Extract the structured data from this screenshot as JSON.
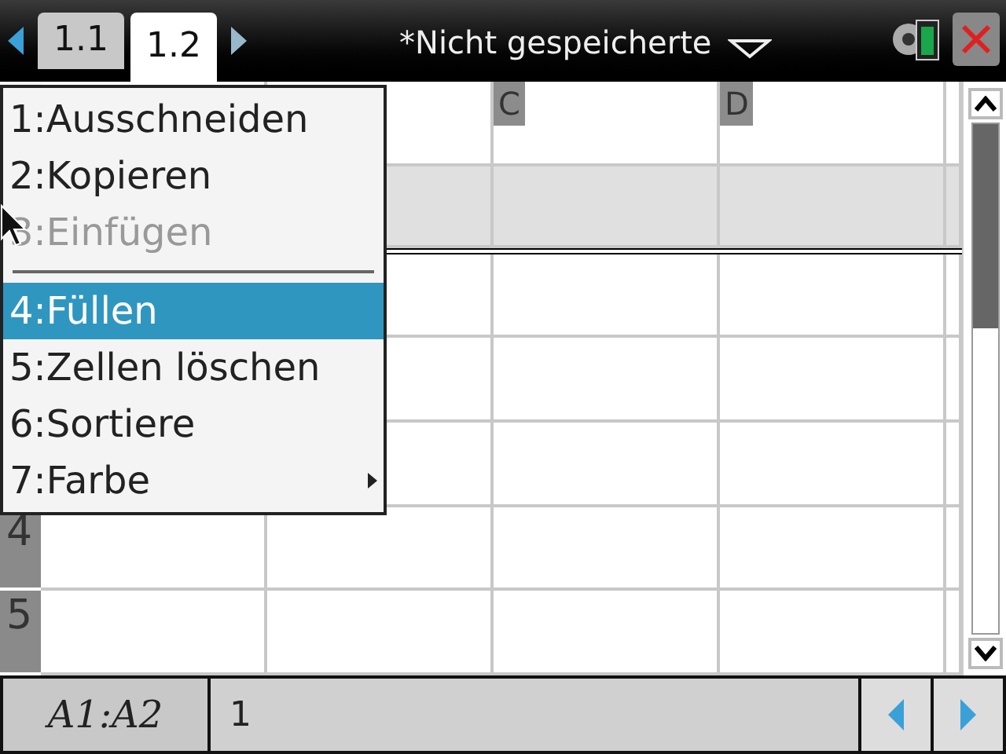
{
  "tabs": [
    {
      "label": "1.1",
      "selected": false
    },
    {
      "label": "1.2",
      "selected": true
    }
  ],
  "document_title": "*Nicht gespeicherte",
  "spreadsheet": {
    "column_headers": [
      "C",
      "D"
    ],
    "row_labels": [
      "4",
      "5"
    ]
  },
  "context_menu": {
    "items": [
      {
        "kind": "item",
        "label": "1:Ausschneiden",
        "disabled": false,
        "selected": false,
        "submenu": false
      },
      {
        "kind": "item",
        "label": "2:Kopieren",
        "disabled": false,
        "selected": false,
        "submenu": false
      },
      {
        "kind": "item",
        "label": "3:Einfügen",
        "disabled": true,
        "selected": false,
        "submenu": false
      },
      {
        "kind": "separator"
      },
      {
        "kind": "item",
        "label": "4:Füllen",
        "disabled": false,
        "selected": true,
        "submenu": false
      },
      {
        "kind": "item",
        "label": "5:Zellen löschen",
        "disabled": false,
        "selected": false,
        "submenu": false
      },
      {
        "kind": "item",
        "label": "6:Sortiere",
        "disabled": false,
        "selected": false,
        "submenu": false
      },
      {
        "kind": "item",
        "label": "7:Farbe",
        "disabled": false,
        "selected": false,
        "submenu": true
      }
    ]
  },
  "entry_bar": {
    "cell_reference": "A1:A2",
    "value": "1"
  }
}
